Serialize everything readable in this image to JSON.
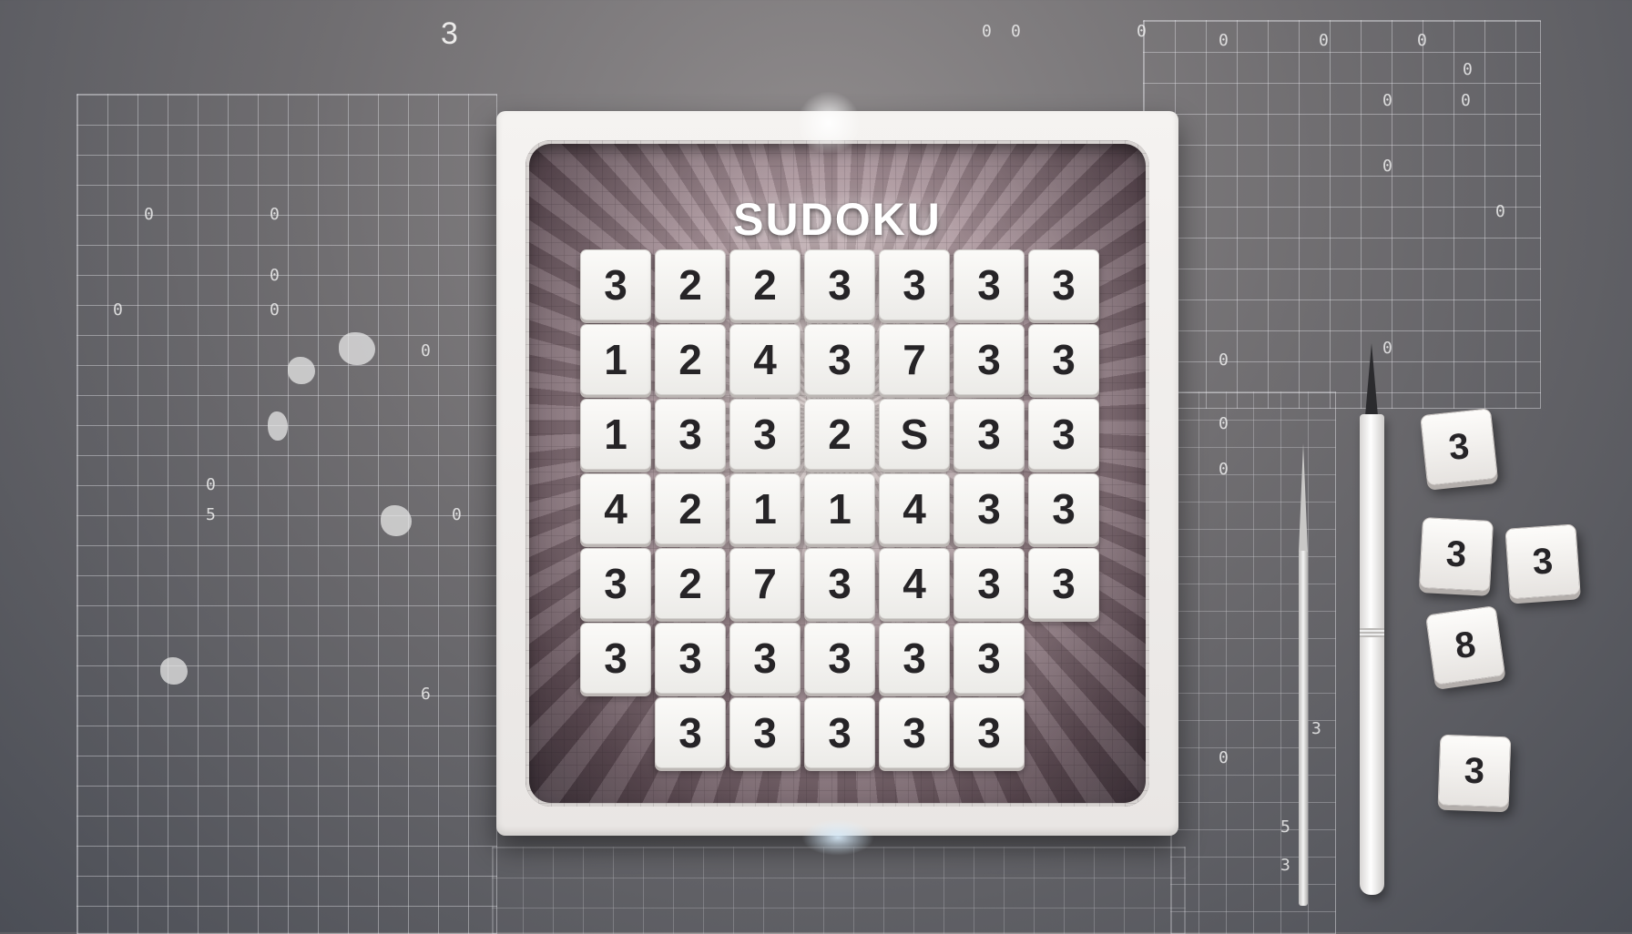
{
  "title": "SUDOKU",
  "board": {
    "rows": [
      [
        "3",
        "2",
        "2",
        "3",
        "3",
        "3",
        "3"
      ],
      [
        "1",
        "2",
        "4",
        "3",
        "7",
        "3",
        "3"
      ],
      [
        "1",
        "3",
        "3",
        "2",
        "S",
        "3",
        "3"
      ],
      [
        "4",
        "2",
        "1",
        "1",
        "4",
        "3",
        "3"
      ],
      [
        "3",
        "2",
        "7",
        "3",
        "4",
        "3",
        "3"
      ],
      [
        "3",
        "3",
        "3",
        "3",
        "3",
        "3",
        ""
      ],
      [
        "",
        "3",
        "3",
        "3",
        "3",
        "3",
        ""
      ]
    ]
  },
  "loose_tiles": [
    "3",
    "3",
    "3",
    "8",
    "3"
  ],
  "scribbles": {
    "top_left_digit": "3",
    "right_grid": [
      "0",
      "0",
      "0",
      "0",
      "0",
      "0",
      "0",
      "0",
      "0",
      "0",
      "0",
      "0"
    ],
    "left_grid": [
      "0",
      "0",
      "0",
      "0",
      "0",
      "0",
      "0",
      "0",
      "5",
      "6"
    ],
    "strip": [
      "0",
      "0",
      "0",
      "0",
      "3",
      "5",
      "3"
    ]
  },
  "colors": {
    "tile_face": "#fbfaf8",
    "digit": "#262427",
    "frame": "#f5f3f1",
    "background": "#6f6d70"
  },
  "icons": {
    "pen": "pen-icon",
    "stylus": "stylus-icon"
  }
}
